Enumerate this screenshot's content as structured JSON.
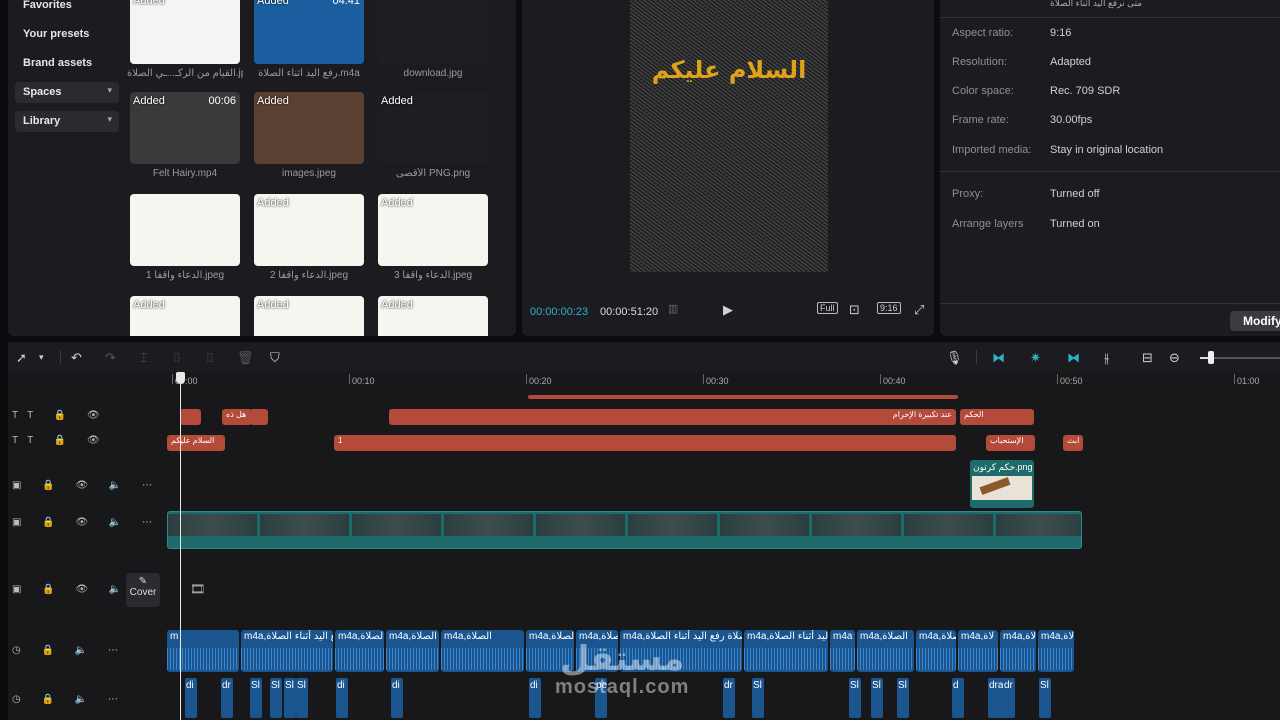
{
  "sidebar": {
    "items": [
      "Favorites",
      "Your presets",
      "Brand assets"
    ],
    "spaces": "Spaces",
    "library": "Library"
  },
  "media": {
    "added_label": "Added",
    "items": [
      {
        "name": "القيام من الركـ...ـي الصلاة.jpeg",
        "duration": "",
        "added": true,
        "color": "#f4f4f4"
      },
      {
        "name": "رفع اليد أثناء الصلاة.m4a",
        "duration": "04:41",
        "added": true,
        "color": "#1b5fa0"
      },
      {
        "name": "download.jpg",
        "duration": "",
        "added": false,
        "color": "#1e1e22"
      },
      {
        "name": "Felt Hairy.mp4",
        "duration": "00:06",
        "added": true,
        "color": "#3a3a3a"
      },
      {
        "name": "images.jpeg",
        "duration": "",
        "added": true,
        "color": "#5a4030"
      },
      {
        "name": "الأقصى PNG.png",
        "duration": "",
        "added": true,
        "color": "#1e1e22"
      },
      {
        "name": "الدعاء واقفاً 1.jpeg",
        "duration": "",
        "added": false,
        "color": "#f6f6f0"
      },
      {
        "name": "الدعاء واقفاً 2.jpeg",
        "duration": "",
        "added": true,
        "color": "#f6f6f0"
      },
      {
        "name": "الدعاء واقفاً 3.jpeg",
        "duration": "",
        "added": true,
        "color": "#f6f6f0"
      },
      {
        "name": "",
        "duration": "",
        "added": true,
        "color": "#f6f6f0"
      },
      {
        "name": "",
        "duration": "",
        "added": true,
        "color": "#f6f6f0"
      },
      {
        "name": "",
        "duration": "",
        "added": true,
        "color": "#f6f6f0"
      }
    ]
  },
  "player": {
    "overlay_text": "السلام عليكم",
    "current_time": "00:00:00:23",
    "total_time": "00:00:51:20",
    "full_label": "Full",
    "ratio_label": "9:16"
  },
  "details": {
    "header": "متى نرفع اليد أثناء الصلاة",
    "rows": [
      {
        "label": "Aspect ratio:",
        "value": "9:16"
      },
      {
        "label": "Resolution:",
        "value": "Adapted"
      },
      {
        "label": "Color space:",
        "value": "Rec. 709 SDR"
      },
      {
        "label": "Frame rate:",
        "value": "30.00fps"
      },
      {
        "label": "Imported media:",
        "value": "Stay in original location"
      },
      {
        "label": "Proxy:",
        "value": "Turned off"
      },
      {
        "label": "Arrange layers",
        "value": "Turned on"
      }
    ],
    "modify_label": "Modify"
  },
  "timeline": {
    "ruler": [
      "00:00",
      "00:10",
      "00:20",
      "00:30",
      "00:40",
      "00:50",
      "01:00"
    ],
    "cover_label": "Cover",
    "text_track1": [
      {
        "label": "",
        "w": "s1"
      },
      {
        "label": "هل ذه",
        "w": "s2"
      },
      {
        "label": "",
        "w": "s3"
      },
      {
        "label": "عند تكبيرة الإحرام",
        "w": "s4"
      },
      {
        "label": "الحكم",
        "w": "s5"
      }
    ],
    "text_track2": [
      {
        "label": "السلام عليكم",
        "w": "t1"
      },
      {
        "label": "1",
        "w": "t2"
      },
      {
        "label": "الإستحباب",
        "w": "t3"
      },
      {
        "label": "ابث",
        "w": "t4"
      }
    ],
    "overlay_clip": "حكم كرتون.png",
    "audio_clips": [
      "m",
      "m4a,رفع اليد أثناء الصلاة",
      "m4a,رفع اليد أثناء الصلاة",
      "m4a,الصلاة",
      "m4a,الصلاة",
      "m4a,رفع اليد أثناء الصلاة",
      "m4a,الصلاة",
      "m4a,صلاة رفع اليد أثناء الصلاة",
      "m4a,رفع اليد أثناء الصلاة",
      "m4a",
      "m4a,الصلاة",
      "m4a,الصلاة",
      "m4a,لاة",
      "m4a,لاة",
      "m4a,لاة"
    ],
    "sfx_clips": [
      "di",
      "dr",
      "Sl",
      "Sl",
      "Sl",
      "Sl",
      "di",
      "di",
      "di",
      "pe",
      "dr",
      "Sl",
      "Sl",
      "Sl",
      "Sl",
      "d",
      "draw",
      "dr",
      "Sl"
    ]
  },
  "watermark": {
    "arabic": "مستقل",
    "latin": "mostaql.com"
  }
}
